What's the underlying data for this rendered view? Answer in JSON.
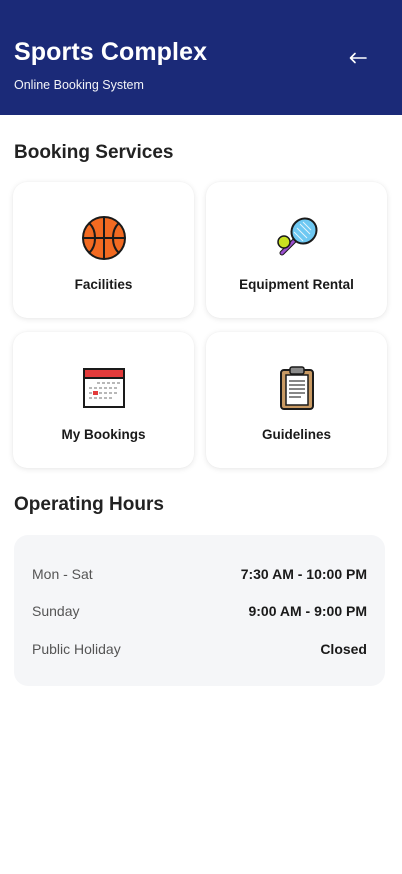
{
  "header": {
    "title": "Sports Complex",
    "subtitle": "Online Booking System",
    "back_icon": "arrow-left-icon",
    "background": "#1b2a78"
  },
  "services": {
    "heading": "Booking Services",
    "items": [
      {
        "label": "Facilities",
        "icon": "basketball-icon"
      },
      {
        "label": "Equipment Rental",
        "icon": "tennis-racket-icon"
      },
      {
        "label": "My Bookings",
        "icon": "calendar-icon"
      },
      {
        "label": "Guidelines",
        "icon": "clipboard-icon"
      }
    ]
  },
  "hours": {
    "heading": "Operating Hours",
    "rows": [
      {
        "day": "Mon - Sat",
        "time": "7:30 AM - 10:00 PM"
      },
      {
        "day": "Sunday",
        "time": "9:00 AM - 9:00 PM"
      },
      {
        "day": "Public Holiday",
        "time": "Closed"
      }
    ]
  }
}
